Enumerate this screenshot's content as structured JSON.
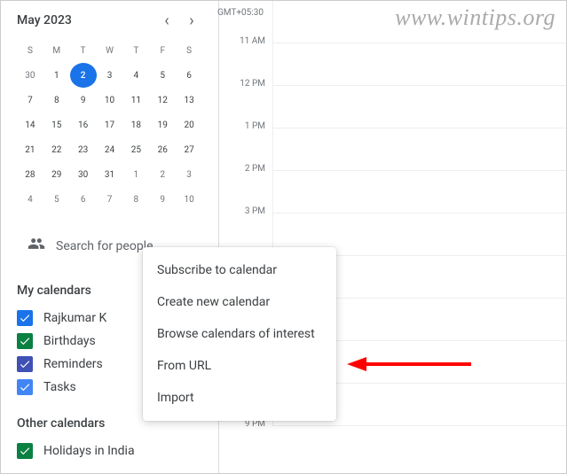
{
  "watermark": "www.wintips.org",
  "calendar": {
    "month_label": "May 2023",
    "tz": "GMT+05:30",
    "day_headers": [
      "S",
      "M",
      "T",
      "W",
      "T",
      "F",
      "S"
    ],
    "weeks": [
      [
        {
          "d": "30",
          "o": true
        },
        {
          "d": "1"
        },
        {
          "d": "2",
          "today": true
        },
        {
          "d": "3"
        },
        {
          "d": "4"
        },
        {
          "d": "5"
        },
        {
          "d": "6"
        }
      ],
      [
        {
          "d": "7"
        },
        {
          "d": "8"
        },
        {
          "d": "9"
        },
        {
          "d": "10"
        },
        {
          "d": "11"
        },
        {
          "d": "12"
        },
        {
          "d": "13"
        }
      ],
      [
        {
          "d": "14"
        },
        {
          "d": "15"
        },
        {
          "d": "16"
        },
        {
          "d": "17"
        },
        {
          "d": "18"
        },
        {
          "d": "19"
        },
        {
          "d": "20"
        }
      ],
      [
        {
          "d": "21"
        },
        {
          "d": "22"
        },
        {
          "d": "23"
        },
        {
          "d": "24"
        },
        {
          "d": "25"
        },
        {
          "d": "26"
        },
        {
          "d": "27"
        }
      ],
      [
        {
          "d": "28"
        },
        {
          "d": "29"
        },
        {
          "d": "30"
        },
        {
          "d": "31"
        },
        {
          "d": "1",
          "o": true
        },
        {
          "d": "2",
          "o": true
        },
        {
          "d": "3",
          "o": true
        }
      ],
      [
        {
          "d": "4",
          "o": true
        },
        {
          "d": "5",
          "o": true
        },
        {
          "d": "6",
          "o": true
        },
        {
          "d": "7",
          "o": true
        },
        {
          "d": "8",
          "o": true
        },
        {
          "d": "9",
          "o": true
        },
        {
          "d": "10",
          "o": true
        }
      ]
    ]
  },
  "search_placeholder": "Search for people",
  "sections": {
    "my": "My calendars",
    "other": "Other calendars"
  },
  "my_calendars": [
    {
      "label": "Rajkumar K",
      "color": "#1a73e8"
    },
    {
      "label": "Birthdays",
      "color": "#0b8043"
    },
    {
      "label": "Reminders",
      "color": "#3f51b5"
    },
    {
      "label": "Tasks",
      "color": "#4285f4"
    }
  ],
  "other_calendars": [
    {
      "label": "Holidays in India",
      "color": "#0b8043"
    }
  ],
  "time_labels": [
    "11 AM",
    "12 PM",
    "1 PM",
    "2 PM",
    "3 PM",
    "",
    "",
    "",
    "",
    "9 PM"
  ],
  "menu": {
    "subscribe": "Subscribe to calendar",
    "create": "Create new calendar",
    "browse": "Browse calendars of interest",
    "from_url": "From URL",
    "import": "Import"
  }
}
